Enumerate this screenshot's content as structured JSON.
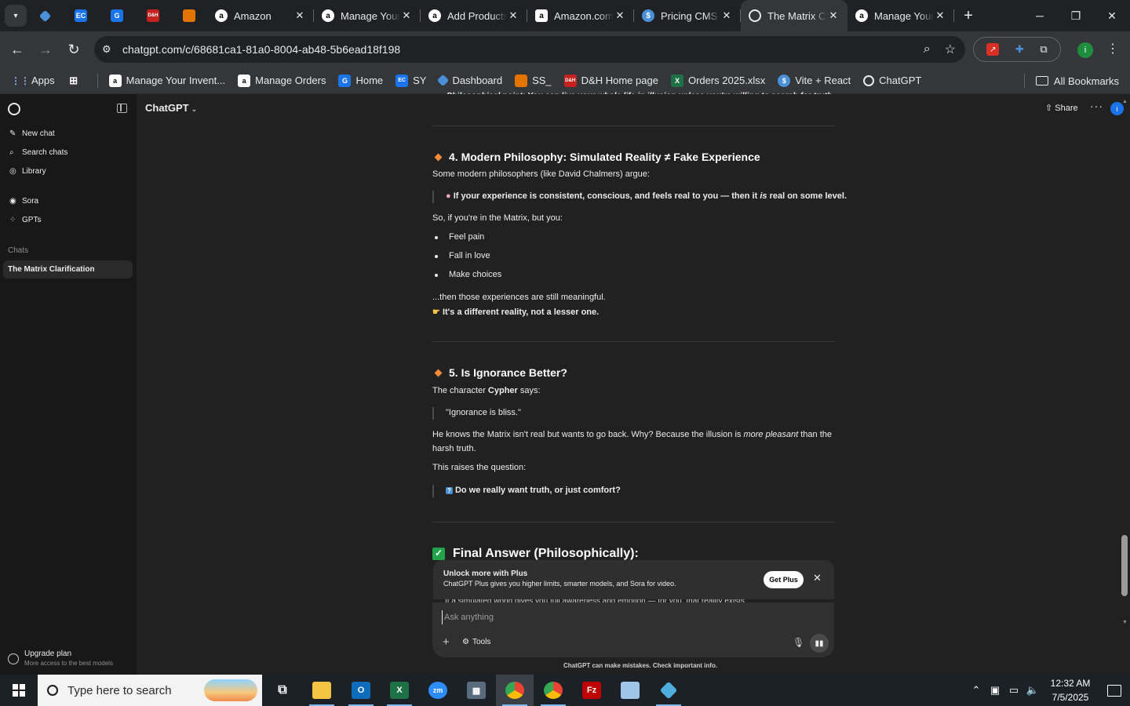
{
  "browser": {
    "pinned_tabs": [
      {
        "icon": "diamond-icon",
        "label": "",
        "color": "#4a90d9"
      },
      {
        "icon": "ec-icon",
        "label": "EC",
        "color": "#1a73e8"
      },
      {
        "icon": "g-icon",
        "label": "G",
        "color": "#1a73e8"
      },
      {
        "icon": "dh-icon",
        "label": "D&H",
        "color": "#c5221f"
      },
      {
        "icon": "box-icon",
        "label": "",
        "color": "#e37400"
      }
    ],
    "tabs": [
      {
        "title": "Amazon",
        "favicon": "a",
        "close": "✕"
      },
      {
        "title": "Manage Your Inventory",
        "favicon": "a",
        "close": "✕"
      },
      {
        "title": "Add Products",
        "favicon": "a",
        "close": "✕"
      },
      {
        "title": "Amazon.com",
        "favicon": "a",
        "close": "✕"
      },
      {
        "title": "Pricing CMS",
        "favicon": "$",
        "close": "✕"
      },
      {
        "title": "The Matrix Clarification",
        "favicon": "",
        "close": "✕"
      },
      {
        "title": "Manage Your Inventory",
        "favicon": "a",
        "close": "✕"
      }
    ],
    "new_tab": "+",
    "url": "chatgpt.com/c/68681ca1-81a0-8004-ab48-5b6ead18f198",
    "bookmarks": [
      {
        "label": "Apps",
        "icon": "apps-grid-icon"
      },
      {
        "label": "",
        "icon": "tab-groups-icon"
      },
      {
        "label": "Manage Your Invent...",
        "icon": "amazon-icon"
      },
      {
        "label": "Manage Orders",
        "icon": "amazon-icon"
      },
      {
        "label": "Home",
        "icon": "g-icon"
      },
      {
        "label": "SY",
        "icon": "ec-icon"
      },
      {
        "label": "Dashboard",
        "icon": "diamond-icon"
      },
      {
        "label": "SS_",
        "icon": "box-icon"
      },
      {
        "label": "D&H Home page",
        "icon": "dh-icon"
      },
      {
        "label": "Orders 2025.xlsx",
        "icon": "excel-icon"
      },
      {
        "label": "Vite + React",
        "icon": "dollar-icon"
      },
      {
        "label": "ChatGPT",
        "icon": "chatgpt-icon"
      }
    ],
    "all_bookmarks": "All Bookmarks"
  },
  "sidebar": {
    "items": [
      {
        "label": "New chat",
        "icon": "edit-icon"
      },
      {
        "label": "Search chats",
        "icon": "search-icon"
      },
      {
        "label": "Library",
        "icon": "library-icon"
      },
      {
        "label": "Sora",
        "icon": "sora-icon"
      },
      {
        "label": "GPTs",
        "icon": "gpts-icon"
      }
    ],
    "chats_heading": "Chats",
    "active_chat": "The Matrix Clarification",
    "upgrade_title": "Upgrade plan",
    "upgrade_sub": "More access to the best models"
  },
  "header": {
    "model": "ChatGPT",
    "share": "Share",
    "more": "···",
    "badge": "i"
  },
  "message": {
    "truncated_top": "Philosophical point: You can live your whole life in illusion unless you're willing to search for truth.",
    "s4_title": "4. Modern Philosophy: Simulated Reality ≠ Fake Experience",
    "s4_intro": "Some modern philosophers (like David Chalmers) argue:",
    "s4_quote_pre": "If your experience is consistent, conscious, and feels real to you — then it ",
    "s4_quote_em": "is",
    "s4_quote_post": " real on some level.",
    "s4_if": "So, if you're in the Matrix, but you:",
    "s4_bullets": [
      "Feel pain",
      "Fall in love",
      "Make choices"
    ],
    "s4_then": "...then those experiences are still meaningful.",
    "s4_point": "It's a different reality, not a lesser one.",
    "s5_title": "5. Is Ignorance Better?",
    "s5_intro_pre": "The character ",
    "s5_intro_name": "Cypher",
    "s5_intro_post": " says:",
    "s5_quote": "\"Ignorance is bliss.\"",
    "s5_body_pre": "He knows the Matrix isn't real but wants to go back. Why? Because the illusion is ",
    "s5_body_em": "more pleasant",
    "s5_body_line1_post": " than the",
    "s5_body_line2": "harsh truth.",
    "s5_raises": "This raises the question:",
    "s5_question": "Do we really want truth, or just comfort?",
    "final_title": "Final Answer (Philosophically):",
    "final_peek": "If a simulated world gives you full awareness and emotion — for you, that reality exists"
  },
  "upsell": {
    "title": "Unlock more with Plus",
    "body": "ChatGPT Plus gives you higher limits, smarter models, and Sora for video.",
    "button": "Get Plus",
    "close": "✕"
  },
  "composer": {
    "placeholder": "Ask anything",
    "value": "",
    "tools": "Tools"
  },
  "disclaimer": "ChatGPT can make mistakes. Check important info.",
  "taskbar": {
    "search_placeholder": "Type here to search",
    "apps": [
      "task-view-icon",
      "file-explorer-icon",
      "outlook-icon",
      "excel-icon",
      "zoom-icon",
      "calculator-icon",
      "chrome-icon",
      "chrome-profile-icon",
      "filezilla-icon",
      "notes-icon",
      "app-diamond-icon"
    ],
    "time": "12:32 AM",
    "date": "7/5/2025"
  },
  "colors": {
    "accent": "#1a73e8",
    "chat_bg": "#212121",
    "sidebar_bg": "#181818",
    "section_marker": "#f28b3a",
    "check_green": "#22a34a"
  }
}
